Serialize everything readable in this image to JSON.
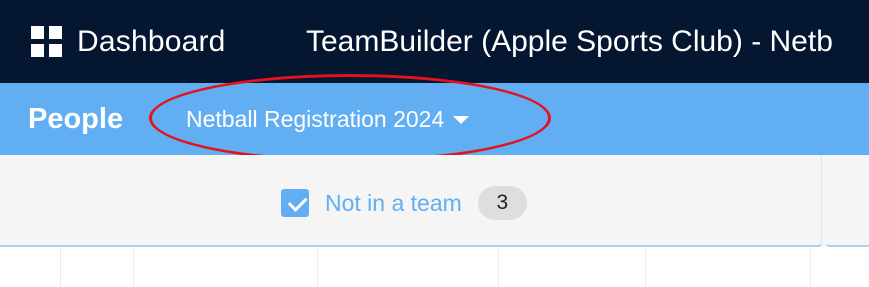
{
  "topbar": {
    "dashboard_label": "Dashboard",
    "dashboard_icon": "grid-icon",
    "app_title": "TeamBuilder (Apple Sports Club) - Netb"
  },
  "people_bar": {
    "title": "People",
    "event_select": {
      "value": "Netball Registration 2024",
      "icon": "caret-down-icon"
    }
  },
  "filter": {
    "checkbox_checked": true,
    "label": "Not in a team",
    "count": "3"
  },
  "colors": {
    "topbar_bg": "#051630",
    "accent": "#62aef2",
    "annotation": "#e3121c",
    "filter_bg": "#f5f5f5",
    "badge_bg": "#dedede"
  }
}
